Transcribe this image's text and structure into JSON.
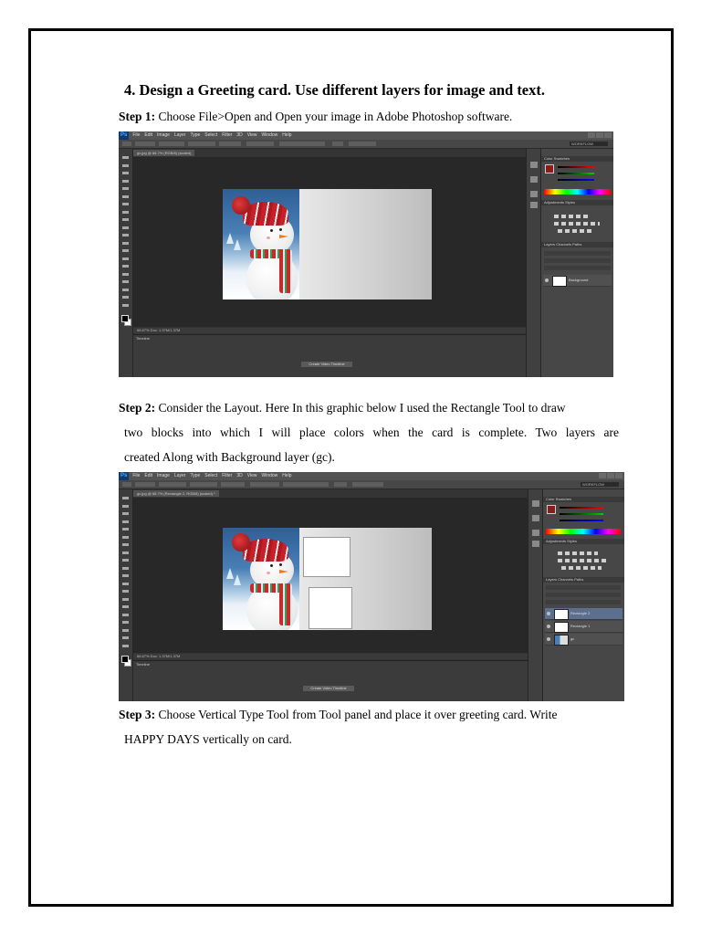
{
  "heading": "4.  Design a Greeting card. Use different layers for image and text.",
  "steps": [
    {
      "label": "Step 1:",
      "line1": " Choose File>Open and Open your image in Adobe Photoshop software."
    },
    {
      "label": "Step 2:",
      "line1": " Consider the Layout. Here In this graphic below I used the Rectangle Tool to draw",
      "line2": "two blocks into which I will place colors when the card is complete. Two layers are",
      "line3": "created Along with Background layer (gc)."
    },
    {
      "label": "Step 3:",
      "line1": " Choose Vertical Type Tool from Tool panel and place it over greeting card. Write",
      "line2": "HAPPY DAYS vertically on card."
    }
  ],
  "screenshot1": {
    "menu": [
      "File",
      "Edit",
      "Image",
      "Layer",
      "Type",
      "Select",
      "Filter",
      "3D",
      "View",
      "Window",
      "Help"
    ],
    "doc_tab": "gc.jpg @ 66.7% (RGB/8) (scaled)",
    "status": "66.67%     Doc: 1.37M/1.37M",
    "timeline_label": "Timeline",
    "timeline_button": "Create Video Timeline",
    "workspace": "WORKFLOW",
    "panel_tabs": [
      "Color   Swatches",
      "Adjustments   Styles",
      "Layers   Channels   Paths"
    ],
    "layers": [
      "Background"
    ]
  },
  "screenshot2": {
    "menu": [
      "File",
      "Edit",
      "Image",
      "Layer",
      "Type",
      "Select",
      "Filter",
      "3D",
      "View",
      "Window",
      "Help"
    ],
    "doc_tab": "gc.jpg @ 66.7% (Rectangle 2, RGB/8) (scaled) *",
    "status": "66.67%     Doc: 1.37M/1.37M",
    "timeline_label": "Timeline",
    "timeline_button": "Create Video Timeline",
    "workspace": "WORKFLOW",
    "panel_tabs": [
      "Color   Swatches",
      "Adjustments   Styles",
      "Layers   Channels   Paths"
    ],
    "layers": [
      "Rectangle 2",
      "Rectangle 1",
      "gc"
    ]
  }
}
